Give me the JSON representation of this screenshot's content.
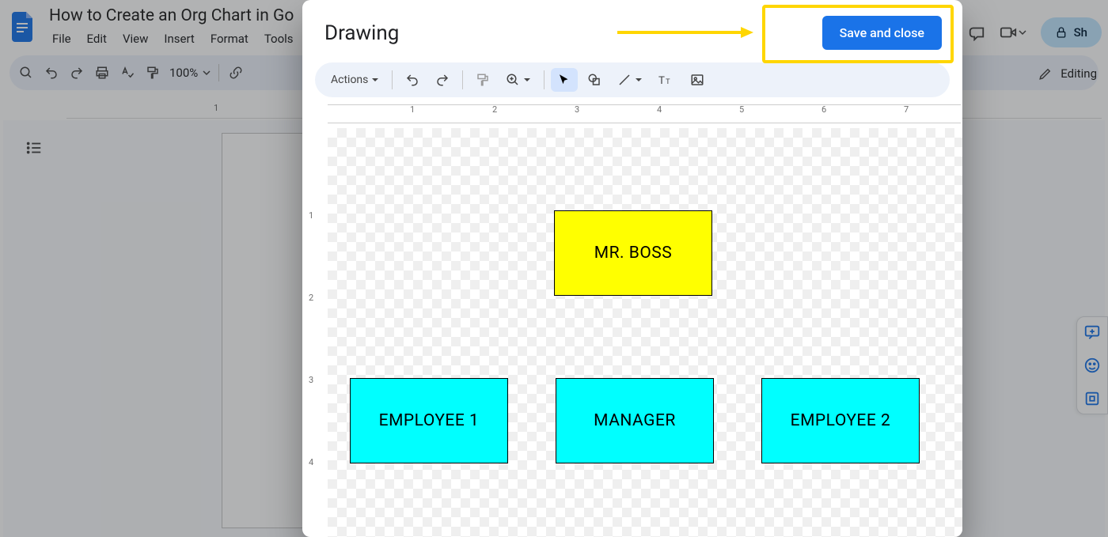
{
  "docs": {
    "title": "How to Create an Org Chart in Go",
    "menu": [
      "File",
      "Edit",
      "View",
      "Insert",
      "Format",
      "Tools"
    ],
    "zoom": "100%",
    "editing_label": "Editing",
    "share_label": "Sh",
    "ruler_h": [
      "1"
    ]
  },
  "dialog": {
    "title": "Drawing",
    "save_label": "Save and close",
    "actions_label": "Actions",
    "ruler_h": [
      "1",
      "2",
      "3",
      "4",
      "5",
      "6",
      "7"
    ],
    "ruler_v": [
      "1",
      "2",
      "3",
      "4"
    ]
  },
  "org": {
    "top": {
      "label": "MR. BOSS"
    },
    "children": [
      {
        "label": "EMPLOYEE 1"
      },
      {
        "label": "MANAGER"
      },
      {
        "label": "EMPLOYEE 2"
      }
    ]
  }
}
